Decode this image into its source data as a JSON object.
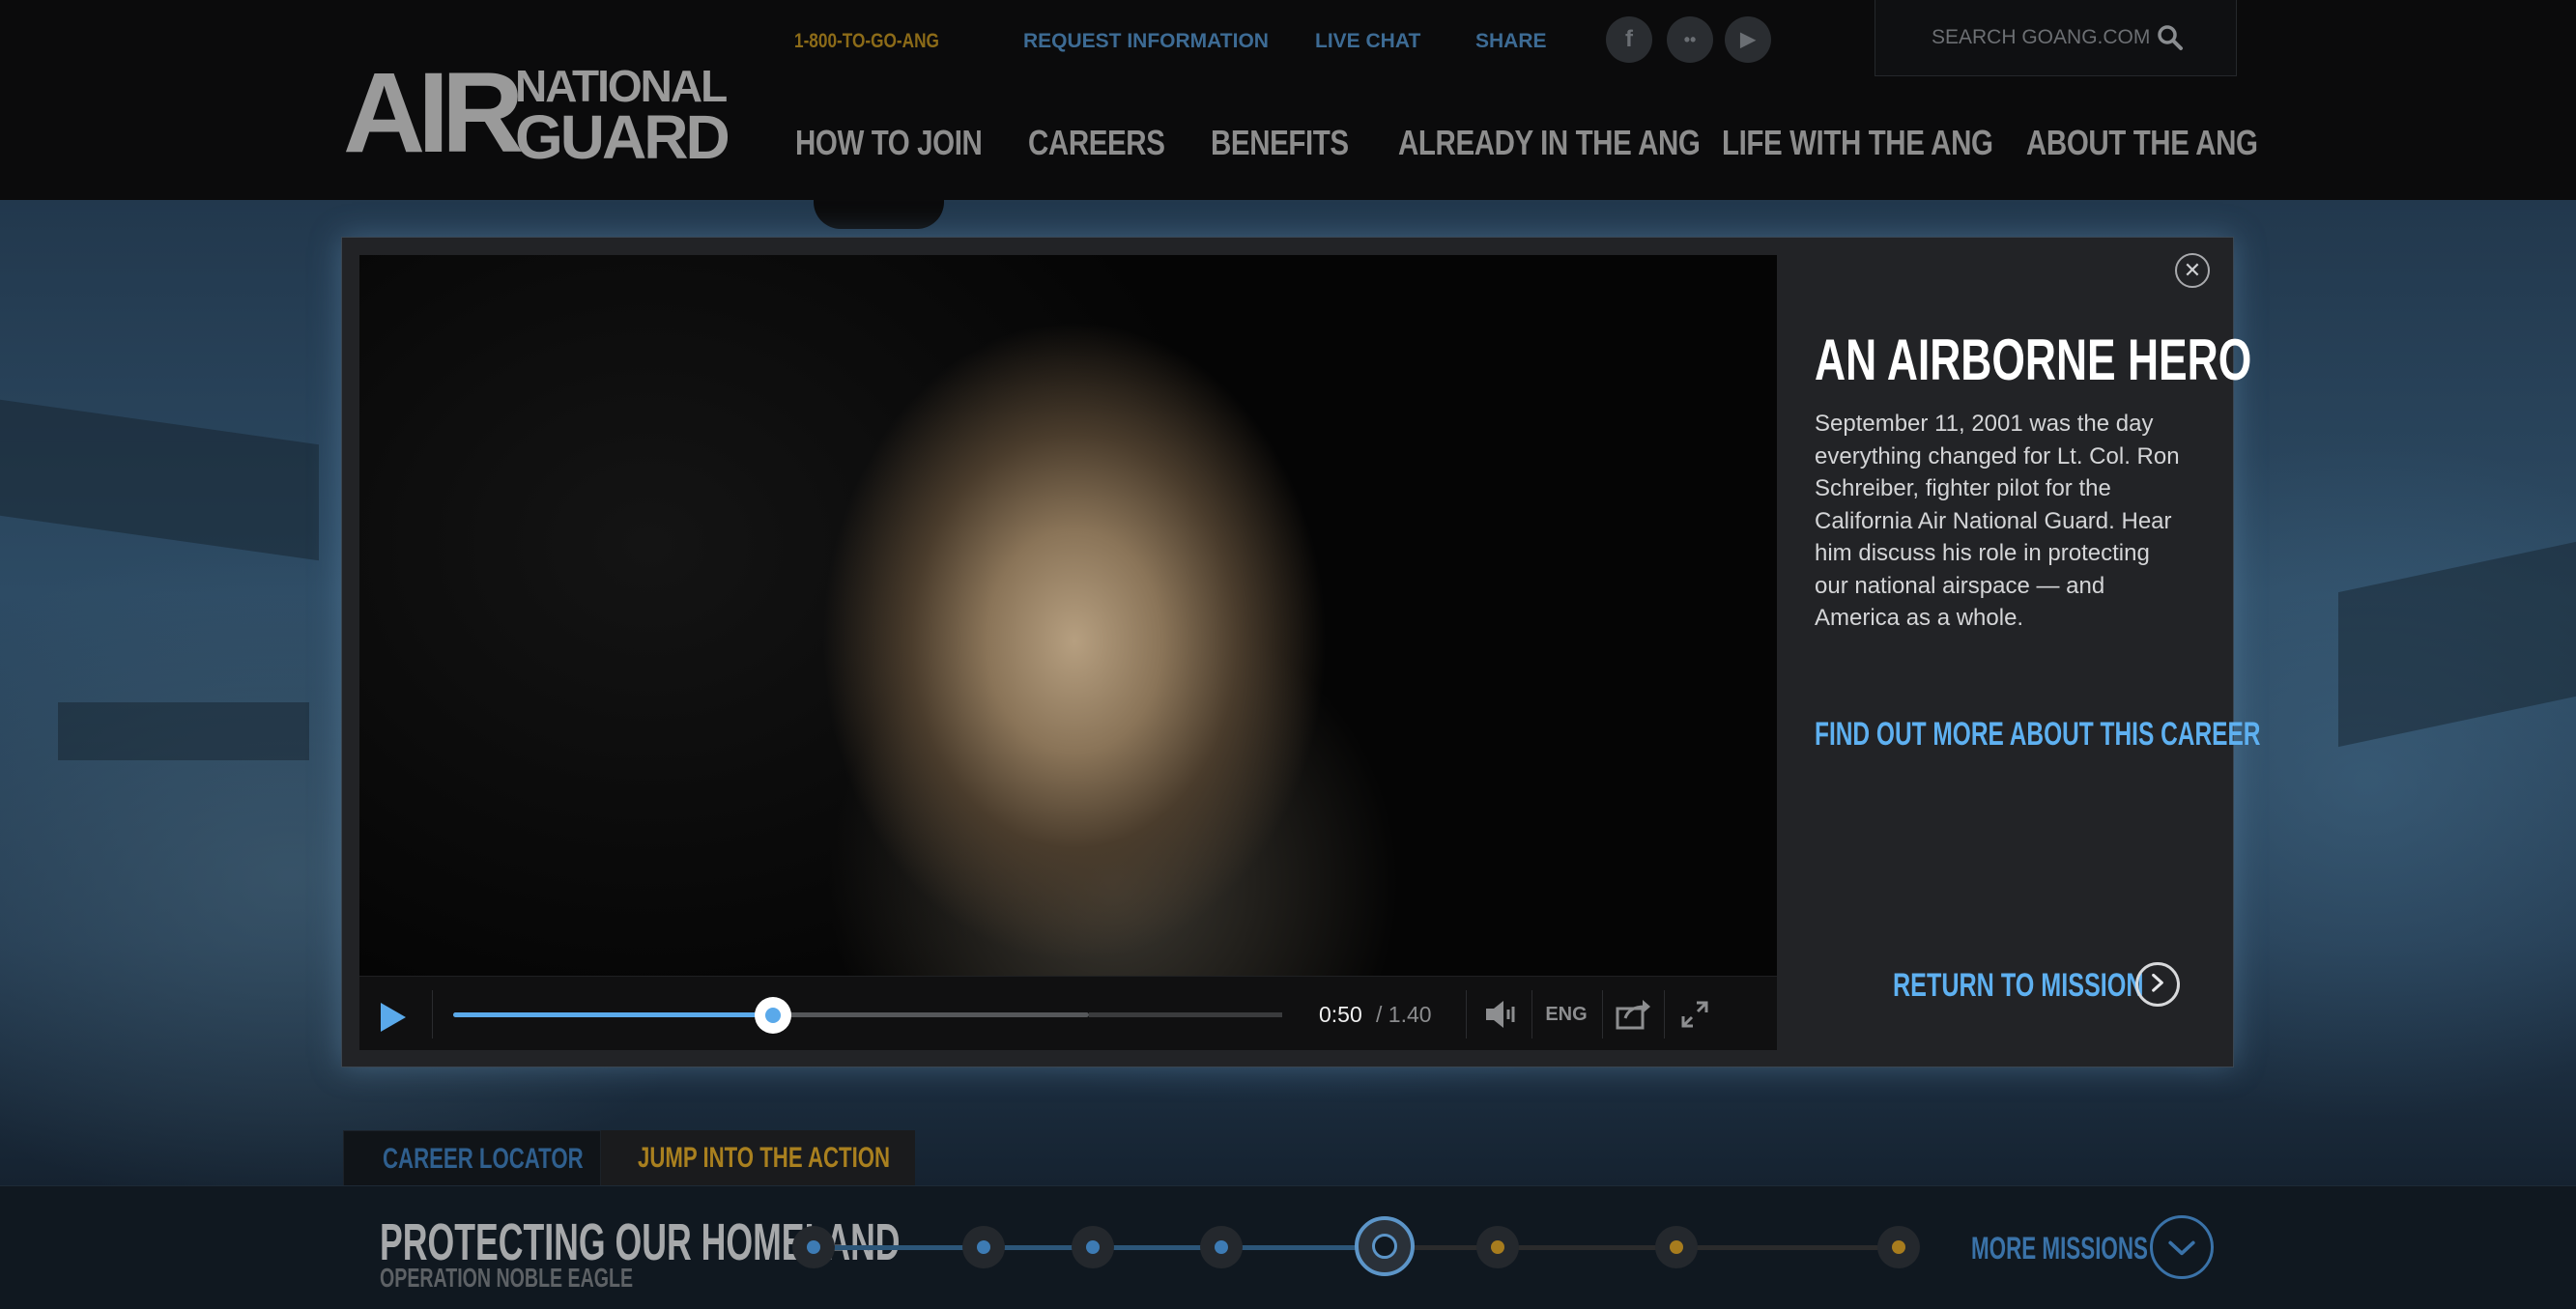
{
  "header": {
    "logo": {
      "air": "AIR",
      "national": "NATIONAL",
      "guard": "GUARD"
    },
    "utility": {
      "phone": "1-800-TO-GO-ANG",
      "request_info": "REQUEST INFORMATION",
      "live_chat": "LIVE CHAT",
      "share": "SHARE"
    },
    "social": {
      "facebook": "f",
      "flickr": "••",
      "youtube": "▶"
    },
    "search": {
      "label": "SEARCH GOANG.COM",
      "icon": "search-icon"
    },
    "nav": [
      {
        "label": "HOW TO JOIN"
      },
      {
        "label": "CAREERS"
      },
      {
        "label": "BENEFITS"
      },
      {
        "label": "ALREADY IN THE ANG"
      },
      {
        "label": "LIFE WITH THE ANG"
      },
      {
        "label": "ABOUT THE ANG"
      }
    ]
  },
  "modal": {
    "title": "AN AIRBORNE HERO",
    "description": "September 11, 2001 was the day everything changed for Lt. Col. Ron Schreiber, fighter pilot for the California Air National Guard. Hear him discuss his role in protecting our national airspace — and America as a whole.",
    "career_link": "FIND OUT MORE ABOUT THIS CAREER",
    "return_link": "RETURN TO MISSION",
    "close_icon": "close-icon",
    "player": {
      "current_time": "0:50",
      "total_time": "/ 1.40",
      "progress": 0.5,
      "language": "ENG",
      "icons": {
        "play": "play-icon",
        "volume": "volume-icon",
        "share": "share-icon",
        "fullscreen": "fullscreen-icon"
      }
    }
  },
  "bottom": {
    "tabs": [
      {
        "label": "CAREER LOCATOR"
      },
      {
        "label": "JUMP INTO THE ACTION"
      }
    ],
    "mission_title": "PROTECTING OUR HOMELAND",
    "mission_subtitle": "OPERATION NOBLE EAGLE",
    "timeline": {
      "total": 8,
      "active_index": 4
    },
    "more_missions": "MORE MISSIONS"
  },
  "colors": {
    "accent_blue": "#5eb0f0",
    "gold": "#a77c1e",
    "header_bg": "#0b0b0c",
    "modal_bg": "#222326"
  }
}
